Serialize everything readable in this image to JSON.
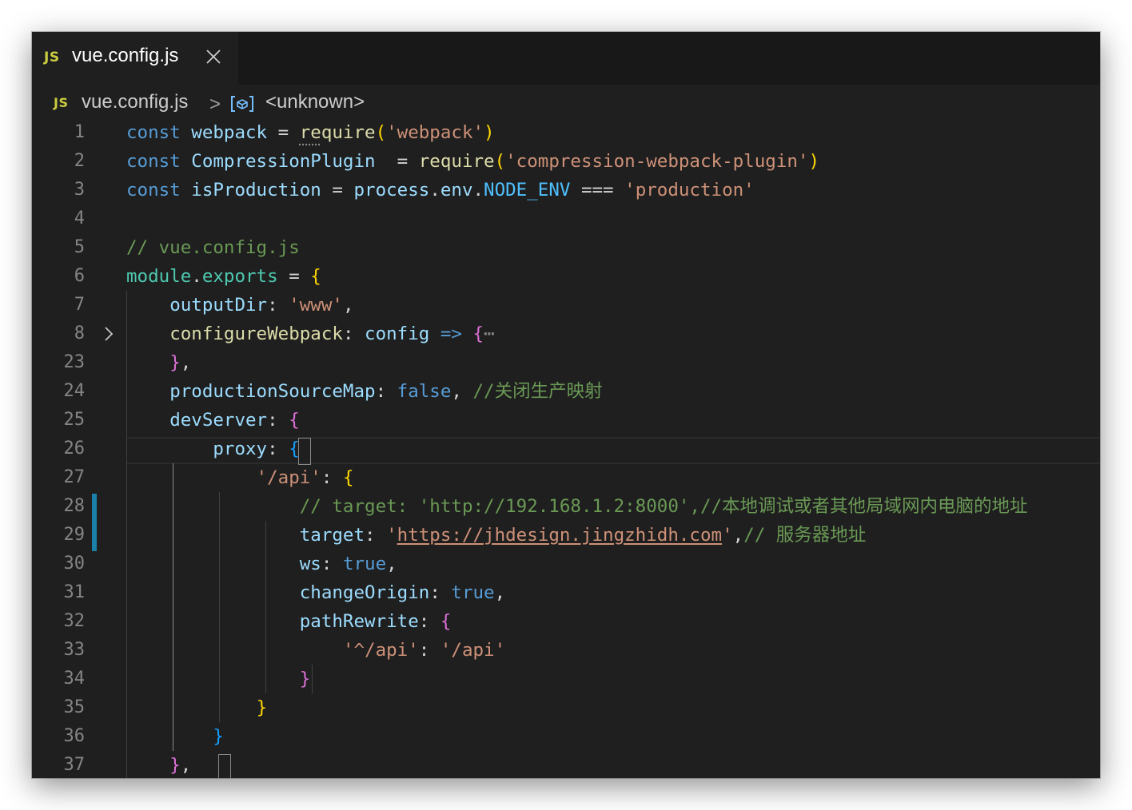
{
  "tab": {
    "badge": "JS",
    "title": "vue.config.js"
  },
  "breadcrumb": {
    "badge": "JS",
    "file": "vue.config.js",
    "separator": ">",
    "symbol": "<unknown>"
  },
  "colors": {
    "editor_bg": "#1f1f1f",
    "tabbar_bg": "#181818",
    "js_badge": "#cbcb41",
    "keyword": "#569cd6",
    "variable": "#9cdcfe",
    "function": "#dcdcaa",
    "string": "#ce9178",
    "comment": "#6a9955",
    "module": "#4ec9b0",
    "bracket_1": "#ffd700",
    "bracket_2": "#da70d6",
    "bracket_3": "#179fff",
    "git_modified": "#1b81a8"
  },
  "lines": [
    {
      "n": "1",
      "tokens": [
        [
          "kw",
          "const"
        ],
        [
          "op",
          " "
        ],
        [
          "var",
          "webpack"
        ],
        [
          "op",
          " = "
        ],
        [
          "fn sq",
          "re"
        ],
        [
          "fn",
          "quire"
        ],
        [
          "b1",
          "("
        ],
        [
          "str",
          "'webpack'"
        ],
        [
          "b1",
          ")"
        ]
      ]
    },
    {
      "n": "2",
      "tokens": [
        [
          "kw",
          "const"
        ],
        [
          "op",
          " "
        ],
        [
          "var",
          "CompressionPlugin"
        ],
        [
          "op",
          "  = "
        ],
        [
          "fn",
          "require"
        ],
        [
          "b1",
          "("
        ],
        [
          "str",
          "'compression-webpack-plugin'"
        ],
        [
          "b1",
          ")"
        ]
      ]
    },
    {
      "n": "3",
      "tokens": [
        [
          "kw",
          "const"
        ],
        [
          "op",
          " "
        ],
        [
          "var",
          "isProduction"
        ],
        [
          "op",
          " = "
        ],
        [
          "var",
          "process"
        ],
        [
          "op",
          "."
        ],
        [
          "var",
          "env"
        ],
        [
          "op",
          "."
        ],
        [
          "cst",
          "NODE_ENV"
        ],
        [
          "op",
          " === "
        ],
        [
          "str",
          "'production'"
        ]
      ]
    },
    {
      "n": "4",
      "tokens": []
    },
    {
      "n": "5",
      "tokens": [
        [
          "com",
          "// vue.config.js"
        ]
      ]
    },
    {
      "n": "6",
      "tokens": [
        [
          "mod",
          "module"
        ],
        [
          "op",
          "."
        ],
        [
          "mod",
          "exports"
        ],
        [
          "op",
          " = "
        ],
        [
          "b1",
          "{"
        ]
      ]
    },
    {
      "n": "7",
      "tokens": [
        [
          "op",
          "    "
        ],
        [
          "var",
          "outputDir"
        ],
        [
          "op",
          ": "
        ],
        [
          "str",
          "'www'"
        ],
        [
          "op",
          ","
        ]
      ]
    },
    {
      "n": "8",
      "tokens": [
        [
          "op",
          "    "
        ],
        [
          "fn",
          "configureWebpack"
        ],
        [
          "op",
          ": "
        ],
        [
          "var",
          "config"
        ],
        [
          "op",
          " "
        ],
        [
          "kw",
          "=>"
        ],
        [
          "op",
          " "
        ],
        [
          "b2",
          "{"
        ],
        [
          "dim",
          "⋯"
        ]
      ],
      "fold": true
    },
    {
      "n": "23",
      "tokens": [
        [
          "op",
          "    "
        ],
        [
          "b2",
          "}"
        ],
        [
          "op",
          ","
        ]
      ]
    },
    {
      "n": "24",
      "tokens": [
        [
          "op",
          "    "
        ],
        [
          "var",
          "productionSourceMap"
        ],
        [
          "op",
          ": "
        ],
        [
          "kw",
          "false"
        ],
        [
          "op",
          ", "
        ],
        [
          "com",
          "//关闭生产映射"
        ]
      ]
    },
    {
      "n": "25",
      "tokens": [
        [
          "op",
          "    "
        ],
        [
          "var",
          "devServer"
        ],
        [
          "op",
          ": "
        ],
        [
          "b2",
          "{"
        ]
      ]
    },
    {
      "n": "26",
      "tokens": [
        [
          "op",
          "        "
        ],
        [
          "var",
          "proxy"
        ],
        [
          "op",
          ": "
        ],
        [
          "b3",
          "{"
        ]
      ]
    },
    {
      "n": "27",
      "tokens": [
        [
          "op",
          "            "
        ],
        [
          "str",
          "'/api'"
        ],
        [
          "op",
          ": "
        ],
        [
          "b1",
          "{"
        ]
      ]
    },
    {
      "n": "28",
      "tokens": [
        [
          "op",
          "                "
        ],
        [
          "com",
          "// target: 'http://192.168.1.2:8000',//本地调试或者其他局域网内电脑的地址"
        ]
      ]
    },
    {
      "n": "29",
      "tokens": [
        [
          "op",
          "                "
        ],
        [
          "var",
          "target"
        ],
        [
          "op",
          ": "
        ],
        [
          "str",
          "'"
        ],
        [
          "url",
          "https://jhdesign.jingzhidh.com"
        ],
        [
          "str",
          "'"
        ],
        [
          "op",
          ","
        ],
        [
          "com",
          "// 服务器地址"
        ]
      ]
    },
    {
      "n": "30",
      "tokens": [
        [
          "op",
          "                "
        ],
        [
          "var",
          "ws"
        ],
        [
          "op",
          ": "
        ],
        [
          "kw",
          "true"
        ],
        [
          "op",
          ","
        ]
      ]
    },
    {
      "n": "31",
      "tokens": [
        [
          "op",
          "                "
        ],
        [
          "var",
          "changeOrigin"
        ],
        [
          "op",
          ": "
        ],
        [
          "kw",
          "true"
        ],
        [
          "op",
          ","
        ]
      ]
    },
    {
      "n": "32",
      "tokens": [
        [
          "op",
          "                "
        ],
        [
          "var",
          "pathRewrite"
        ],
        [
          "op",
          ": "
        ],
        [
          "b2",
          "{"
        ]
      ]
    },
    {
      "n": "33",
      "tokens": [
        [
          "op",
          "                    "
        ],
        [
          "str",
          "'^/api'"
        ],
        [
          "op",
          ": "
        ],
        [
          "str",
          "'/api'"
        ]
      ]
    },
    {
      "n": "34",
      "tokens": [
        [
          "op",
          "                "
        ],
        [
          "b2",
          "}"
        ]
      ]
    },
    {
      "n": "35",
      "tokens": [
        [
          "op",
          "            "
        ],
        [
          "b1",
          "}"
        ]
      ]
    },
    {
      "n": "36",
      "tokens": [
        [
          "op",
          "        "
        ],
        [
          "b3",
          "}"
        ]
      ]
    },
    {
      "n": "37",
      "tokens": [
        [
          "op",
          "    "
        ],
        [
          "b2",
          "}"
        ],
        [
          "op",
          ","
        ]
      ]
    }
  ]
}
